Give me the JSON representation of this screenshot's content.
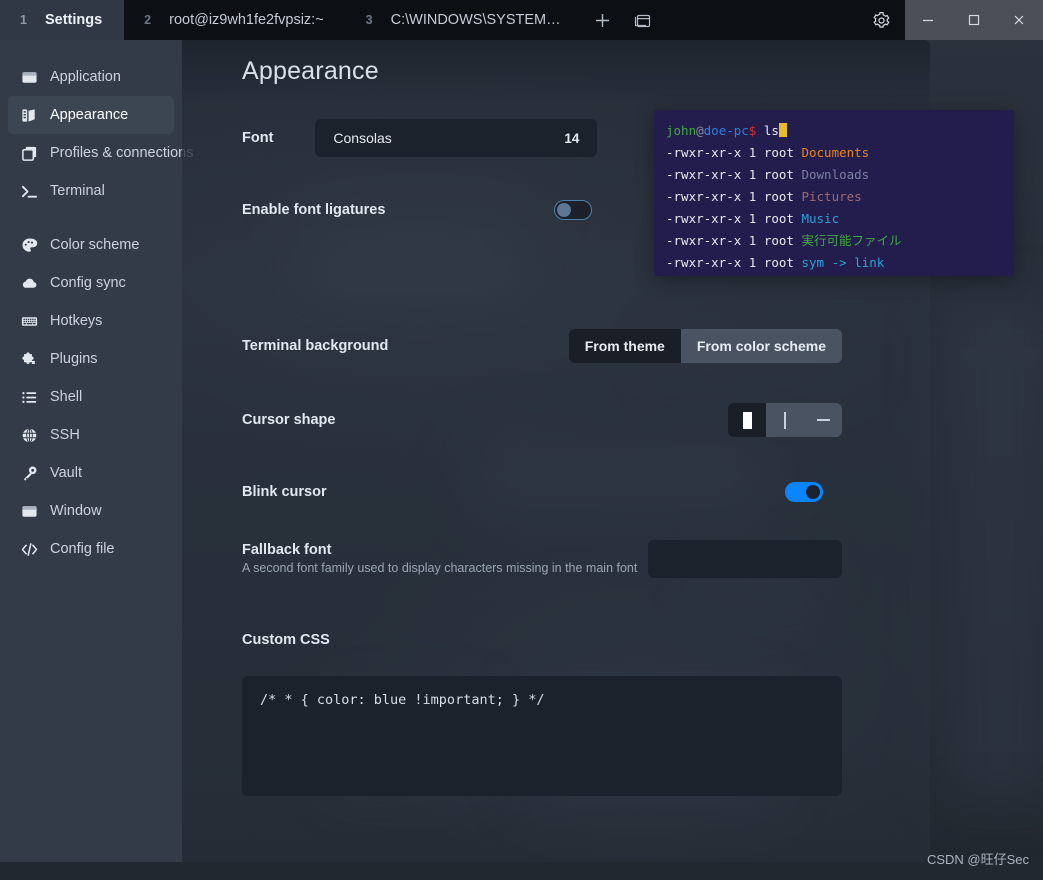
{
  "titlebar": {
    "tabs": [
      {
        "num": "1",
        "label": "Settings",
        "active": true
      },
      {
        "num": "2",
        "label": "root@iz9wh1fe2fvpsiz:~",
        "active": false
      },
      {
        "num": "3",
        "label": "C:\\WINDOWS\\SYSTEM…",
        "active": false
      }
    ],
    "new_tab_icon": "plus-icon",
    "split_icon": "window-split-icon",
    "gear_icon": "gear-icon",
    "window_controls": {
      "minimize": "−",
      "maximize": "□",
      "close": "✕"
    }
  },
  "sidebar": {
    "groups": [
      {
        "items": [
          {
            "label": "Application",
            "icon": "application-icon",
            "active": false
          },
          {
            "label": "Appearance",
            "icon": "appearance-icon",
            "active": true
          },
          {
            "label": "Profiles & connections",
            "icon": "profiles-icon",
            "active": false
          },
          {
            "label": "Terminal",
            "icon": "terminal-icon",
            "active": false
          }
        ]
      },
      {
        "items": [
          {
            "label": "Color scheme",
            "icon": "palette-icon",
            "active": false
          },
          {
            "label": "Config sync",
            "icon": "cloud-icon",
            "active": false
          },
          {
            "label": "Hotkeys",
            "icon": "keyboard-icon",
            "active": false
          },
          {
            "label": "Plugins",
            "icon": "puzzle-icon",
            "active": false
          },
          {
            "label": "Shell",
            "icon": "list-icon",
            "active": false
          },
          {
            "label": "SSH",
            "icon": "globe-icon",
            "active": false
          },
          {
            "label": "Vault",
            "icon": "key-icon",
            "active": false
          },
          {
            "label": "Window",
            "icon": "window-icon",
            "active": false
          },
          {
            "label": "Config file",
            "icon": "code-icon",
            "active": false
          }
        ]
      }
    ]
  },
  "page": {
    "title": "Appearance",
    "font": {
      "label": "Font",
      "family_value": "Consolas",
      "size_value": "14"
    },
    "ligatures": {
      "label": "Enable font ligatures",
      "state": "off"
    },
    "terminal_background": {
      "label": "Terminal background",
      "options": [
        "From theme",
        "From color scheme"
      ],
      "selected": "From theme"
    },
    "cursor_shape": {
      "label": "Cursor shape",
      "options": [
        "block",
        "beam",
        "underline"
      ],
      "selected": "block"
    },
    "blink_cursor": {
      "label": "Blink cursor",
      "state": "on"
    },
    "fallback_font": {
      "label": "Fallback font",
      "description": "A second font family used to display characters missing in the main font",
      "value": "",
      "placeholder": ""
    },
    "custom_css": {
      "label": "Custom CSS",
      "value": "/* * { color: blue !important; } */"
    }
  },
  "terminal_preview": {
    "background": "#231d4e",
    "prompt": {
      "user": "john",
      "at": "@",
      "host": "doe-pc",
      "dollar": "$",
      "command": "ls"
    },
    "lines": [
      {
        "perm": "-rwxr-xr-x 1 root ",
        "name": "Documents",
        "color": "#e8821b"
      },
      {
        "perm": "-rwxr-xr-x 1 root ",
        "name": "Downloads",
        "color": "#7b7f9e"
      },
      {
        "perm": "-rwxr-xr-x 1 root ",
        "name": "Pictures",
        "color": "#9a6a72"
      },
      {
        "perm": "-rwxr-xr-x 1 root ",
        "name": "Music",
        "color": "#2f9fd8"
      },
      {
        "perm": "-rwxr-xr-x 1 root ",
        "name": "実行可能ファイル",
        "color": "#3fa93f"
      },
      {
        "perm": "-rwxr-xr-x 1 root ",
        "name": "sym -> link",
        "color": "#2f9fd8"
      }
    ],
    "colors": {
      "user": "#3fa93f",
      "at": "#8a8f9e",
      "host": "#2f7fd8",
      "dollar": "#d12f2f",
      "command": "#e6e9f0",
      "perm": "#e6e9f0",
      "cursor": "#e8bb2d"
    }
  },
  "watermark": {
    "text": "CSDN @旺仔Sec"
  },
  "colors": {
    "accent": "#0a84ff",
    "sidebar_bg": "#333b47",
    "field_bg": "#1c222c",
    "titlebar_bg": "#0c0f14"
  }
}
